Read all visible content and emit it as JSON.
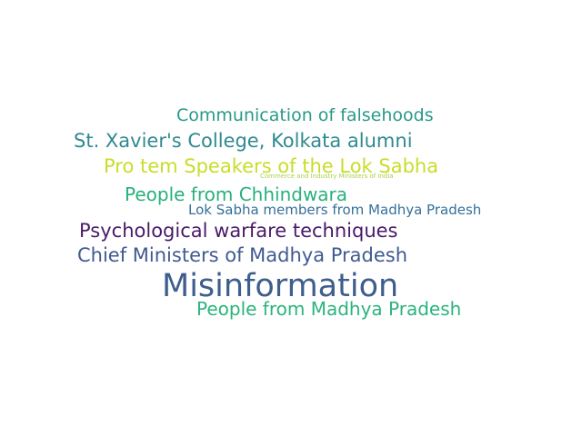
{
  "words": [
    {
      "text": "Communication of falsehoods",
      "color": "#2a9a8a"
    },
    {
      "text": "St. Xavier's College, Kolkata alumni",
      "color": "#2f8a90"
    },
    {
      "text": "Pro tem Speakers of the Lok Sabha",
      "color": "#c9dd2a"
    },
    {
      "text": "Commerce and Industry Ministers of India",
      "color": "#a8d04a"
    },
    {
      "text": "People from Chhindwara",
      "color": "#28b07c"
    },
    {
      "text": "Lok Sabha members from Madhya Pradesh",
      "color": "#34709a"
    },
    {
      "text": "Psychological warfare techniques",
      "color": "#4a1a68"
    },
    {
      "text": "Chief Ministers of Madhya Pradesh",
      "color": "#405a90"
    },
    {
      "text": "Misinformation",
      "color": "#3e5e8c"
    },
    {
      "text": "People from Madhya Pradesh",
      "color": "#2bb47c"
    }
  ]
}
